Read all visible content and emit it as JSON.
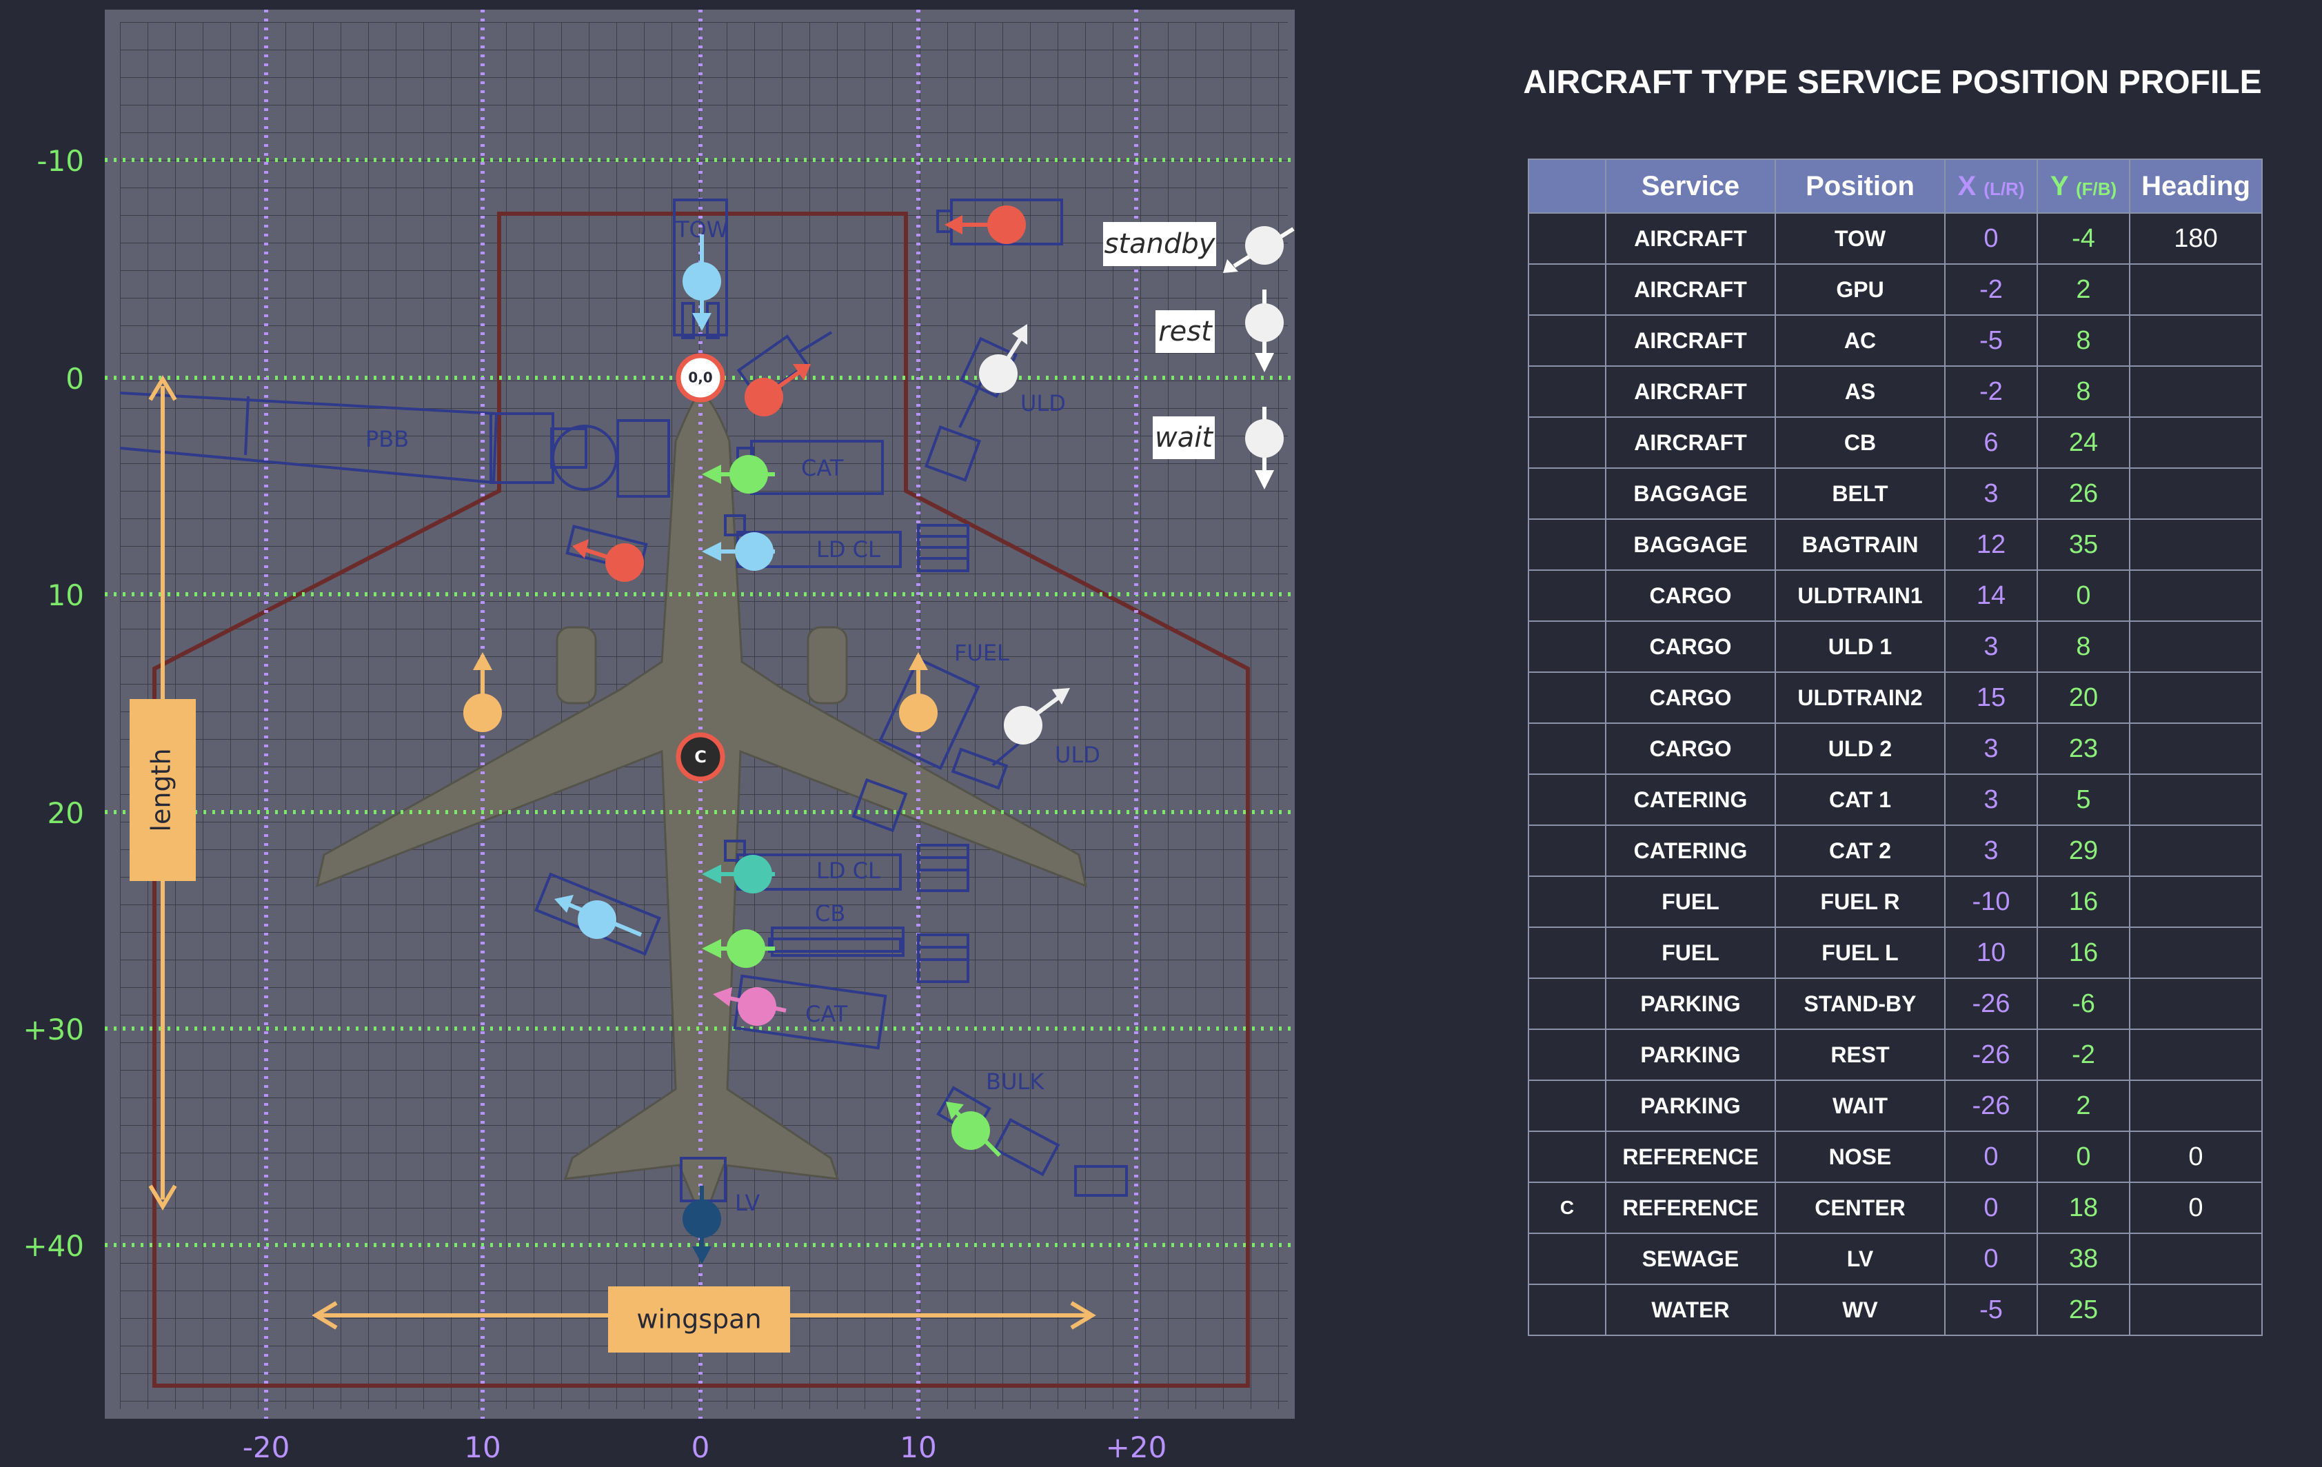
{
  "title": "AIRCRAFT TYPE SERVICE POSITION PROFILE",
  "colors": {
    "background": "#272a36",
    "panel": "#5f6170",
    "grid": "#3a3c46",
    "lat_guide": "#b893ff",
    "long_guide": "#7ee86a",
    "boundary": "#6b2b2b",
    "dimension": "#f5bb6c",
    "header": "#6f7cb3"
  },
  "diagram": {
    "y_axis_labels": [
      "-10",
      "0",
      "10",
      "20",
      "+30",
      "+40"
    ],
    "x_axis_labels": [
      "-20",
      "10",
      "0",
      "10",
      "+20"
    ],
    "origin_label": "0,0",
    "center_label": "C",
    "length_label": "length",
    "wingspan_label": "wingspan",
    "legend": {
      "standby": "standby",
      "rest": "rest",
      "wait": "wait"
    },
    "vehicle_labels": {
      "tow": "TOW",
      "pbb": "PBB",
      "uld_top": "ULD",
      "uld_mid": "ULD",
      "cat_top": "CAT",
      "ldcl_top": "LD CL",
      "ldcl_bottom": "LD CL",
      "fuel": "FUEL",
      "cb": "CB",
      "cat_bottom": "CAT",
      "bulk": "BULK",
      "lv": "LV"
    },
    "markers": [
      {
        "name": "tow-marker",
        "color": "#8fd3f4"
      },
      {
        "name": "gpu-marker",
        "color": "#ea5b4b"
      },
      {
        "name": "uldtrain1-marker",
        "color": "#f0f0f0"
      },
      {
        "name": "cat1-marker",
        "color": "#7ee86a"
      },
      {
        "name": "uld1-marker",
        "color": "#8fd3f4"
      },
      {
        "name": "ac-marker",
        "color": "#ea5b4b"
      },
      {
        "name": "fuel-l-marker",
        "color": "#f5bb6c"
      },
      {
        "name": "fuel-r-marker",
        "color": "#f5bb6c"
      },
      {
        "name": "uldtrain2-marker",
        "color": "#f0f0f0"
      },
      {
        "name": "uld2-marker",
        "color": "#4ac9b0"
      },
      {
        "name": "wv-marker",
        "color": "#8fd3f4"
      },
      {
        "name": "belt-marker",
        "color": "#7ee86a"
      },
      {
        "name": "cat2-marker",
        "color": "#e77fc2"
      },
      {
        "name": "bagtrain-marker",
        "color": "#7ee86a"
      },
      {
        "name": "lv-marker",
        "color": "#1f4d7a"
      },
      {
        "name": "cb-marker",
        "color": "#ea5b4b"
      }
    ]
  },
  "table": {
    "headers": {
      "mark": "",
      "service": "Service",
      "position": "Position",
      "x": "X",
      "x_sub": "(L/R)",
      "y": "Y",
      "y_sub": "(F/B)",
      "heading": "Heading"
    },
    "rows": [
      {
        "mark": "",
        "service": "AIRCRAFT",
        "position": "TOW",
        "x": "0",
        "y": "-4",
        "heading": "180"
      },
      {
        "mark": "",
        "service": "AIRCRAFT",
        "position": "GPU",
        "x": "-2",
        "y": "2",
        "heading": ""
      },
      {
        "mark": "",
        "service": "AIRCRAFT",
        "position": "AC",
        "x": "-5",
        "y": "8",
        "heading": ""
      },
      {
        "mark": "",
        "service": "AIRCRAFT",
        "position": "AS",
        "x": "-2",
        "y": "8",
        "heading": ""
      },
      {
        "mark": "",
        "service": "AIRCRAFT",
        "position": "CB",
        "x": "6",
        "y": "24",
        "heading": ""
      },
      {
        "mark": "",
        "service": "BAGGAGE",
        "position": "BELT",
        "x": "3",
        "y": "26",
        "heading": ""
      },
      {
        "mark": "",
        "service": "BAGGAGE",
        "position": "BAGTRAIN",
        "x": "12",
        "y": "35",
        "heading": ""
      },
      {
        "mark": "",
        "service": "CARGO",
        "position": "ULDTRAIN1",
        "x": "14",
        "y": "0",
        "heading": ""
      },
      {
        "mark": "",
        "service": "CARGO",
        "position": "ULD 1",
        "x": "3",
        "y": "8",
        "heading": ""
      },
      {
        "mark": "",
        "service": "CARGO",
        "position": "ULDTRAIN2",
        "x": "15",
        "y": "20",
        "heading": ""
      },
      {
        "mark": "",
        "service": "CARGO",
        "position": "ULD 2",
        "x": "3",
        "y": "23",
        "heading": ""
      },
      {
        "mark": "",
        "service": "CATERING",
        "position": "CAT 1",
        "x": "3",
        "y": "5",
        "heading": ""
      },
      {
        "mark": "",
        "service": "CATERING",
        "position": "CAT 2",
        "x": "3",
        "y": "29",
        "heading": ""
      },
      {
        "mark": "",
        "service": "FUEL",
        "position": "FUEL R",
        "x": "-10",
        "y": "16",
        "heading": ""
      },
      {
        "mark": "",
        "service": "FUEL",
        "position": "FUEL L",
        "x": "10",
        "y": "16",
        "heading": ""
      },
      {
        "mark": "",
        "service": "PARKING",
        "position": "STAND-BY",
        "x": "-26",
        "y": "-6",
        "heading": ""
      },
      {
        "mark": "",
        "service": "PARKING",
        "position": "REST",
        "x": "-26",
        "y": "-2",
        "heading": ""
      },
      {
        "mark": "",
        "service": "PARKING",
        "position": "WAIT",
        "x": "-26",
        "y": "2",
        "heading": ""
      },
      {
        "mark": "",
        "service": "REFERENCE",
        "position": "NOSE",
        "x": "0",
        "y": "0",
        "heading": "0"
      },
      {
        "mark": "C",
        "service": "REFERENCE",
        "position": "CENTER",
        "x": "0",
        "y": "18",
        "heading": "0"
      },
      {
        "mark": "",
        "service": "SEWAGE",
        "position": "LV",
        "x": "0",
        "y": "38",
        "heading": ""
      },
      {
        "mark": "",
        "service": "WATER",
        "position": "WV",
        "x": "-5",
        "y": "25",
        "heading": ""
      }
    ]
  }
}
